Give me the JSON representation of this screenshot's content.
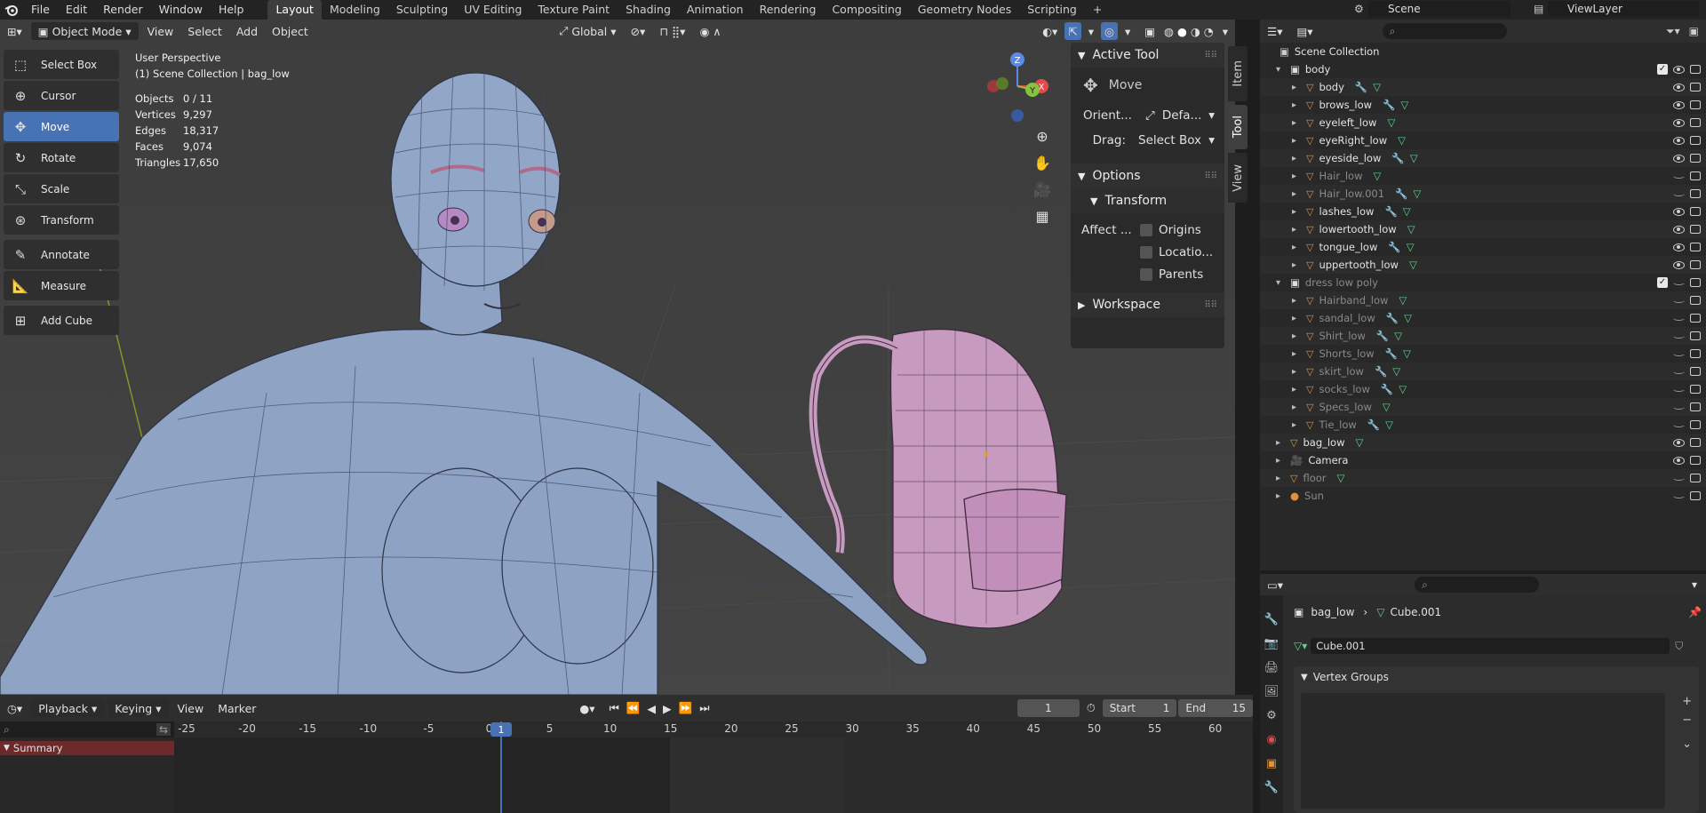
{
  "topbar": {
    "menus": [
      "File",
      "Edit",
      "Render",
      "Window",
      "Help"
    ],
    "workspaces": [
      "Layout",
      "Modeling",
      "Sculpting",
      "UV Editing",
      "Texture Paint",
      "Shading",
      "Animation",
      "Rendering",
      "Compositing",
      "Geometry Nodes",
      "Scripting"
    ],
    "active_workspace": "Layout",
    "add_tab": "+",
    "scene": "Scene",
    "view_layer": "ViewLayer"
  },
  "viewport_header": {
    "mode": "Object Mode",
    "menus": [
      "View",
      "Select",
      "Add",
      "Object"
    ],
    "orientation": "Global"
  },
  "toolbar": {
    "tools": [
      {
        "label": "Select Box",
        "icon": "select-box-icon"
      },
      {
        "label": "Cursor",
        "icon": "cursor-icon"
      },
      {
        "label": "Move",
        "icon": "move-icon"
      },
      {
        "label": "Rotate",
        "icon": "rotate-icon"
      },
      {
        "label": "Scale",
        "icon": "scale-icon"
      },
      {
        "label": "Transform",
        "icon": "transform-icon"
      },
      {
        "label": "Annotate",
        "icon": "annotate-icon"
      },
      {
        "label": "Measure",
        "icon": "measure-icon"
      },
      {
        "label": "Add Cube",
        "icon": "add-cube-icon"
      }
    ],
    "active_tool": "Move"
  },
  "overlay_stats": {
    "view": "User Perspective",
    "context": "(1) Scene Collection | bag_low",
    "rows": [
      {
        "k": "Objects",
        "v": "0 / 11"
      },
      {
        "k": "Vertices",
        "v": "9,297"
      },
      {
        "k": "Edges",
        "v": "18,317"
      },
      {
        "k": "Faces",
        "v": "9,074"
      },
      {
        "k": "Triangles",
        "v": "17,650"
      }
    ]
  },
  "gizmo": {
    "x": "X",
    "y": "Y",
    "z": "Z"
  },
  "npanel": {
    "tabs": [
      "Item",
      "Tool",
      "View"
    ],
    "active_tab": "Tool",
    "active_tool_title": "Active Tool",
    "tool_name": "Move",
    "orient_label": "Orient...",
    "orient_value": "Defa...",
    "drag_label": "Drag:",
    "drag_value": "Select Box",
    "options_title": "Options",
    "transform_title": "Transform",
    "affect_label": "Affect ...",
    "affect_options": [
      "Origins",
      "Locatio...",
      "Parents"
    ],
    "workspace_title": "Workspace"
  },
  "outliner": {
    "root": "Scene Collection",
    "rows": [
      {
        "name": "body",
        "level": 1,
        "type": "collection",
        "dim": false,
        "exp": "open"
      },
      {
        "name": "body",
        "level": 2,
        "type": "mesh",
        "dim": false
      },
      {
        "name": "brows_low",
        "level": 2,
        "type": "mesh",
        "dim": false
      },
      {
        "name": "eyeleft_low",
        "level": 2,
        "type": "mesh",
        "dim": false
      },
      {
        "name": "eyeRight_low",
        "level": 2,
        "type": "mesh",
        "dim": false
      },
      {
        "name": "eyeside_low",
        "level": 2,
        "type": "mesh",
        "dim": false
      },
      {
        "name": "Hair_low",
        "level": 2,
        "type": "mesh",
        "dim": true
      },
      {
        "name": "Hair_low.001",
        "level": 2,
        "type": "mesh",
        "dim": true
      },
      {
        "name": "lashes_low",
        "level": 2,
        "type": "mesh",
        "dim": false
      },
      {
        "name": "lowertooth_low",
        "level": 2,
        "type": "mesh",
        "dim": false
      },
      {
        "name": "tongue_low",
        "level": 2,
        "type": "mesh",
        "dim": false
      },
      {
        "name": "uppertooth_low",
        "level": 2,
        "type": "mesh",
        "dim": false
      },
      {
        "name": "dress low poly",
        "level": 1,
        "type": "collection",
        "dim": true,
        "exp": "open"
      },
      {
        "name": "Hairband_low",
        "level": 2,
        "type": "mesh",
        "dim": true
      },
      {
        "name": "sandal_low",
        "level": 2,
        "type": "mesh",
        "dim": true
      },
      {
        "name": "Shirt_low",
        "level": 2,
        "type": "mesh",
        "dim": true
      },
      {
        "name": "Shorts_low",
        "level": 2,
        "type": "mesh",
        "dim": true
      },
      {
        "name": "skirt_low",
        "level": 2,
        "type": "mesh",
        "dim": true
      },
      {
        "name": "socks_low",
        "level": 2,
        "type": "mesh",
        "dim": true
      },
      {
        "name": "Specs_low",
        "level": 2,
        "type": "mesh",
        "dim": true
      },
      {
        "name": "Tie_low",
        "level": 2,
        "type": "mesh",
        "dim": true
      },
      {
        "name": "bag_low",
        "level": 1,
        "type": "mesh",
        "dim": false
      },
      {
        "name": "Camera",
        "level": 1,
        "type": "camera",
        "dim": false
      },
      {
        "name": "floor",
        "level": 1,
        "type": "mesh",
        "dim": true
      },
      {
        "name": "Sun",
        "level": 1,
        "type": "light",
        "dim": true
      }
    ]
  },
  "properties": {
    "breadcrumb_object": "bag_low",
    "breadcrumb_data": "Cube.001",
    "data_name": "Cube.001",
    "panel_title": "Vertex Groups"
  },
  "timeline": {
    "menus": [
      "Playback",
      "Keying",
      "View",
      "Marker"
    ],
    "current_frame": "1",
    "start_label": "Start",
    "start_value": "1",
    "end_label": "End",
    "end_value": "15",
    "ticks": [
      "-25",
      "-20",
      "-15",
      "-10",
      "-5",
      "0",
      "5",
      "10",
      "15",
      "20",
      "25",
      "30",
      "35",
      "40",
      "45",
      "50",
      "55",
      "60"
    ],
    "playhead": "1",
    "summary": "Summary"
  },
  "colors": {
    "accent": "#4772b3",
    "mesh_body": "#8fa3c4",
    "mesh_bag": "#c79ac0",
    "object_orange": "#e0913a",
    "data_green": "#5fd18f"
  }
}
